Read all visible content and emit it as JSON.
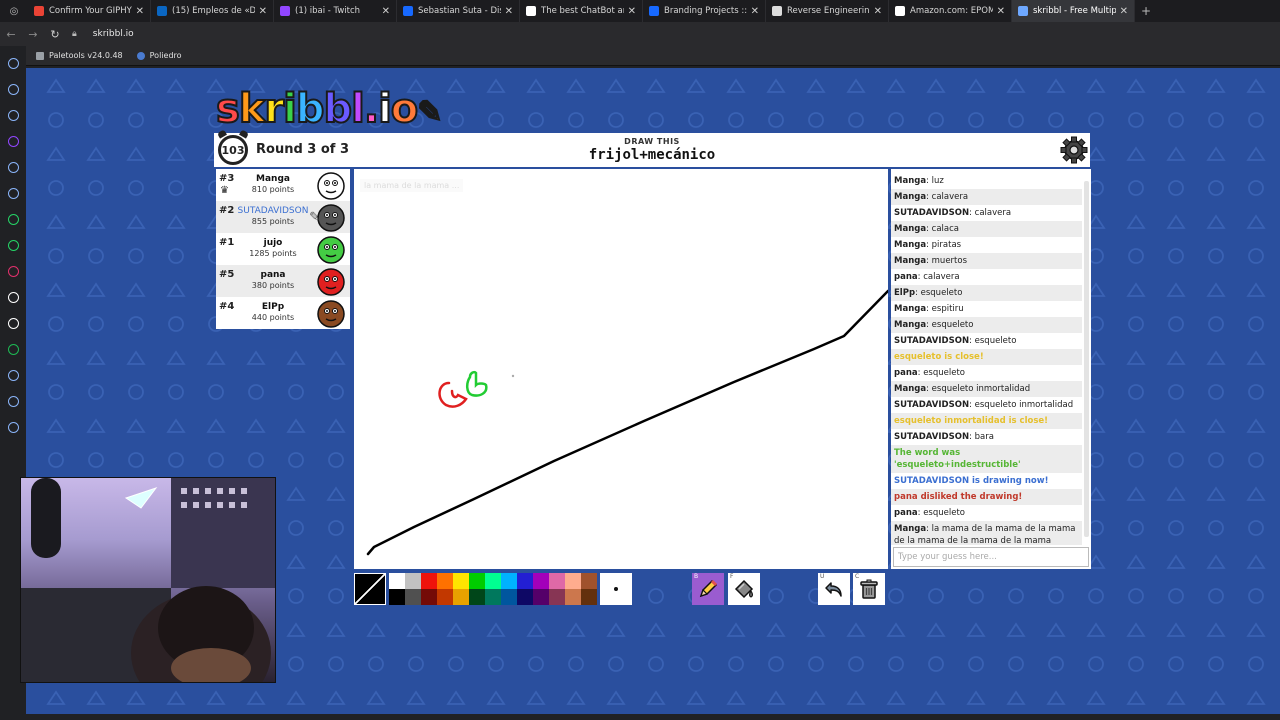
{
  "browser": {
    "tabs": [
      {
        "title": "Confirm Your GIPHY Acc",
        "color": "#ea4335"
      },
      {
        "title": "(15) Empleos de «Diseña",
        "color": "#0a66c2"
      },
      {
        "title": "(1) ibai - Twitch",
        "color": "#9146ff"
      },
      {
        "title": "Sebastian Suta - Diseña",
        "color": "#1769ff"
      },
      {
        "title": "The best ChatBot and W",
        "color": "#ffffff"
      },
      {
        "title": "Branding Projects :: Phot",
        "color": "#1769ff"
      },
      {
        "title": "Reverse Engineering - Se",
        "color": "#dddddd"
      },
      {
        "title": "Amazon.com: EPOMAKE",
        "color": "#ffffff"
      },
      {
        "title": "skribbl - Free Multiplaye",
        "color": "#6ea8ff",
        "active": true
      }
    ],
    "url": "skribbl.io",
    "bookmarks": [
      "Paletools v24.0.48",
      "Poliedro"
    ]
  },
  "header": {
    "logo": "skribbl.io",
    "timer": "103",
    "round": "Round 3 of 3",
    "draw_label": "DRAW THIS",
    "word": "frijol+mecánico"
  },
  "players": [
    {
      "rank": "#3",
      "name": "Manga",
      "points": "810 points",
      "avatar_color": "#ffffff",
      "crown": true
    },
    {
      "rank": "#2",
      "name": "SUTADAVIDSON",
      "points": "855 points",
      "avatar_color": "#555555",
      "me": true
    },
    {
      "rank": "#1",
      "name": "jujo",
      "points": "1285 points",
      "avatar_color": "#44cc44"
    },
    {
      "rank": "#5",
      "name": "pana",
      "points": "380 points",
      "avatar_color": "#e02020"
    },
    {
      "rank": "#4",
      "name": "ElPp",
      "points": "440 points",
      "avatar_color": "#8a4a22"
    }
  ],
  "canvas": {
    "hint": "la mama de la mama ..."
  },
  "chat": {
    "messages": [
      {
        "user": "Manga",
        "text": "luz",
        "kind": "normal"
      },
      {
        "user": "Manga",
        "text": "calavera",
        "kind": "normal"
      },
      {
        "user": "SUTADAVIDSON",
        "text": "calavera",
        "kind": "normal"
      },
      {
        "user": "Manga",
        "text": "calaca",
        "kind": "normal"
      },
      {
        "user": "Manga",
        "text": "piratas",
        "kind": "normal"
      },
      {
        "user": "Manga",
        "text": "muertos",
        "kind": "normal"
      },
      {
        "user": "pana",
        "text": "calavera",
        "kind": "normal"
      },
      {
        "user": "ElPp",
        "text": "esqueleto",
        "kind": "normal"
      },
      {
        "user": "Manga",
        "text": "espitiru",
        "kind": "normal"
      },
      {
        "user": "Manga",
        "text": "esqueleto",
        "kind": "normal"
      },
      {
        "user": "SUTADAVIDSON",
        "text": "esqueleto",
        "kind": "normal"
      },
      {
        "user": "",
        "text": "esqueleto is close!",
        "kind": "close"
      },
      {
        "user": "pana",
        "text": "esqueleto",
        "kind": "normal"
      },
      {
        "user": "Manga",
        "text": "esqueleto inmortalidad",
        "kind": "normal"
      },
      {
        "user": "SUTADAVIDSON",
        "text": "esqueleto inmortalidad",
        "kind": "normal"
      },
      {
        "user": "",
        "text": "esqueleto inmortalidad is close!",
        "kind": "close"
      },
      {
        "user": "SUTADAVIDSON",
        "text": "bara",
        "kind": "normal"
      },
      {
        "user": "",
        "text": "The word was 'esqueleto+indestructible'",
        "kind": "green"
      },
      {
        "user": "",
        "text": "SUTADAVIDSON is drawing now!",
        "kind": "blue"
      },
      {
        "user": "",
        "text": "pana disliked the drawing!",
        "kind": "red"
      },
      {
        "user": "pana",
        "text": "esqueleto",
        "kind": "normal"
      },
      {
        "user": "Manga",
        "text": "la mama de la mama de la mama de la mama de la mama de la mama",
        "kind": "normal"
      }
    ],
    "placeholder": "Type your guess here..."
  },
  "toolbar": {
    "palette_top": [
      "#ffffff",
      "#c1c1c1",
      "#ef130b",
      "#ff7100",
      "#ffe400",
      "#00cc00",
      "#00ff91",
      "#00b2ff",
      "#231fd3",
      "#a300ba",
      "#df69a7",
      "#ffac8e",
      "#a0522d"
    ],
    "palette_bottom": [
      "#000000",
      "#505050",
      "#740b07",
      "#c23800",
      "#e8a200",
      "#004619",
      "#00785d",
      "#00569e",
      "#0e0865",
      "#550069",
      "#873554",
      "#cc774d",
      "#63300d"
    ],
    "pencil_key": "B",
    "fill_key": "F",
    "undo_key": "U",
    "clear_key": "C"
  }
}
